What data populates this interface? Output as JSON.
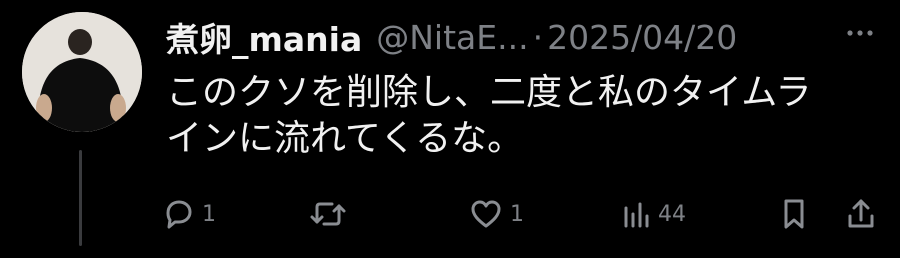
{
  "post": {
    "display_name": "煮卵_mania",
    "handle": "@NitaE...",
    "separator": "·",
    "date": "2025/04/20",
    "text_lines": [
      "このクソを削除し、二度と私のタイムラ",
      "インに流れてくるな。"
    ]
  },
  "actions": {
    "reply_count": "1",
    "repost_count": "",
    "like_count": "1",
    "views_count": "44"
  },
  "icons": {
    "more": "more-dots-icon",
    "reply": "reply-icon",
    "repost": "repost-icon",
    "like": "heart-icon",
    "views": "views-bar-chart-icon",
    "bookmark": "bookmark-icon",
    "share": "share-icon"
  },
  "colors": {
    "background": "#000000",
    "text": "#e7e9ea",
    "muted": "#7e8186"
  }
}
